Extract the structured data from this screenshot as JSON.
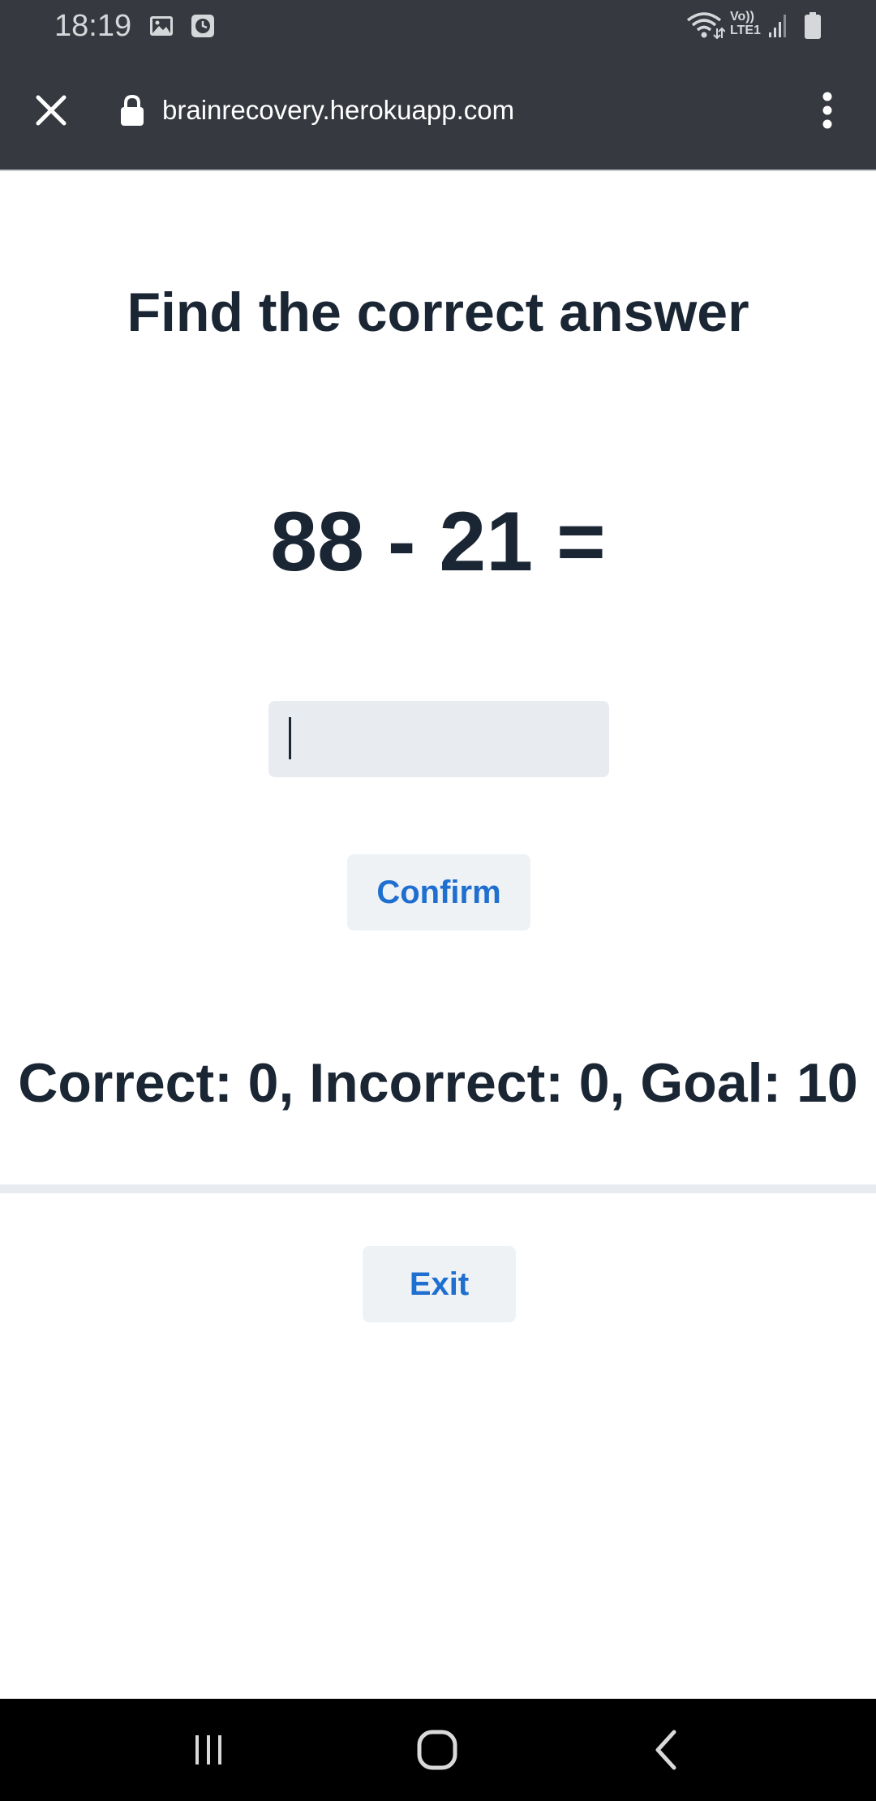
{
  "status_bar": {
    "time": "18:19",
    "network_label_top": "Vo))",
    "network_label_bottom": "LTE1",
    "icons": [
      "gallery-icon",
      "clock-icon",
      "wifi-icon",
      "signal-icon",
      "battery-icon"
    ]
  },
  "browser": {
    "url": "brainrecovery.herokuapp.com",
    "icons": [
      "close-icon",
      "lock-icon",
      "more-vert-icon"
    ]
  },
  "page": {
    "title": "Find the correct answer",
    "equation": "88 - 21 =",
    "answer_value": "",
    "confirm_label": "Confirm",
    "score": "Correct: 0, Incorrect: 0, Goal: 10",
    "exit_label": "Exit"
  },
  "nav_bar": {
    "icons": [
      "recent-apps-icon",
      "home-icon",
      "back-icon"
    ]
  },
  "colors": {
    "chrome_bar": "#36393f",
    "text_dark": "#1b2634",
    "link_blue": "#1f6fd1",
    "input_bg": "#e8ebef",
    "button_bg": "#eff2f5",
    "nav_bg": "#000000"
  }
}
